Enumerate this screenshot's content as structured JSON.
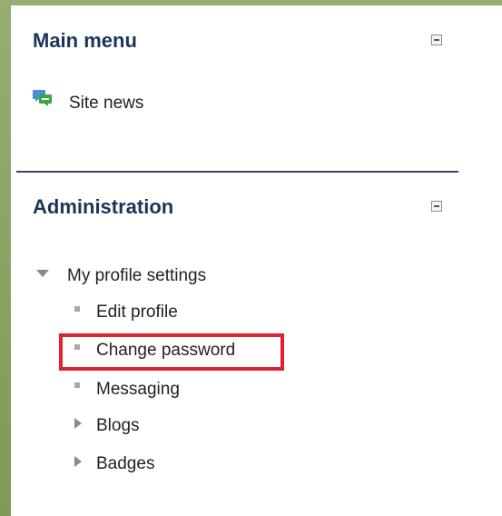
{
  "main_menu": {
    "title": "Main menu",
    "items": [
      {
        "label": "Site news",
        "icon": "chat-bubbles-icon"
      }
    ]
  },
  "administration": {
    "title": "Administration",
    "tree": {
      "group_label": "My profile settings",
      "items": [
        {
          "label": "Edit profile",
          "type": "leaf"
        },
        {
          "label": "Change password",
          "type": "leaf",
          "highlighted": true
        },
        {
          "label": "Messaging",
          "type": "leaf"
        },
        {
          "label": "Blogs",
          "type": "branch"
        },
        {
          "label": "Badges",
          "type": "branch"
        }
      ]
    }
  },
  "colors": {
    "title_text": "#1b3458",
    "divider": "#33456a",
    "highlight": "#e0222c",
    "background_green": "#8fa768"
  }
}
